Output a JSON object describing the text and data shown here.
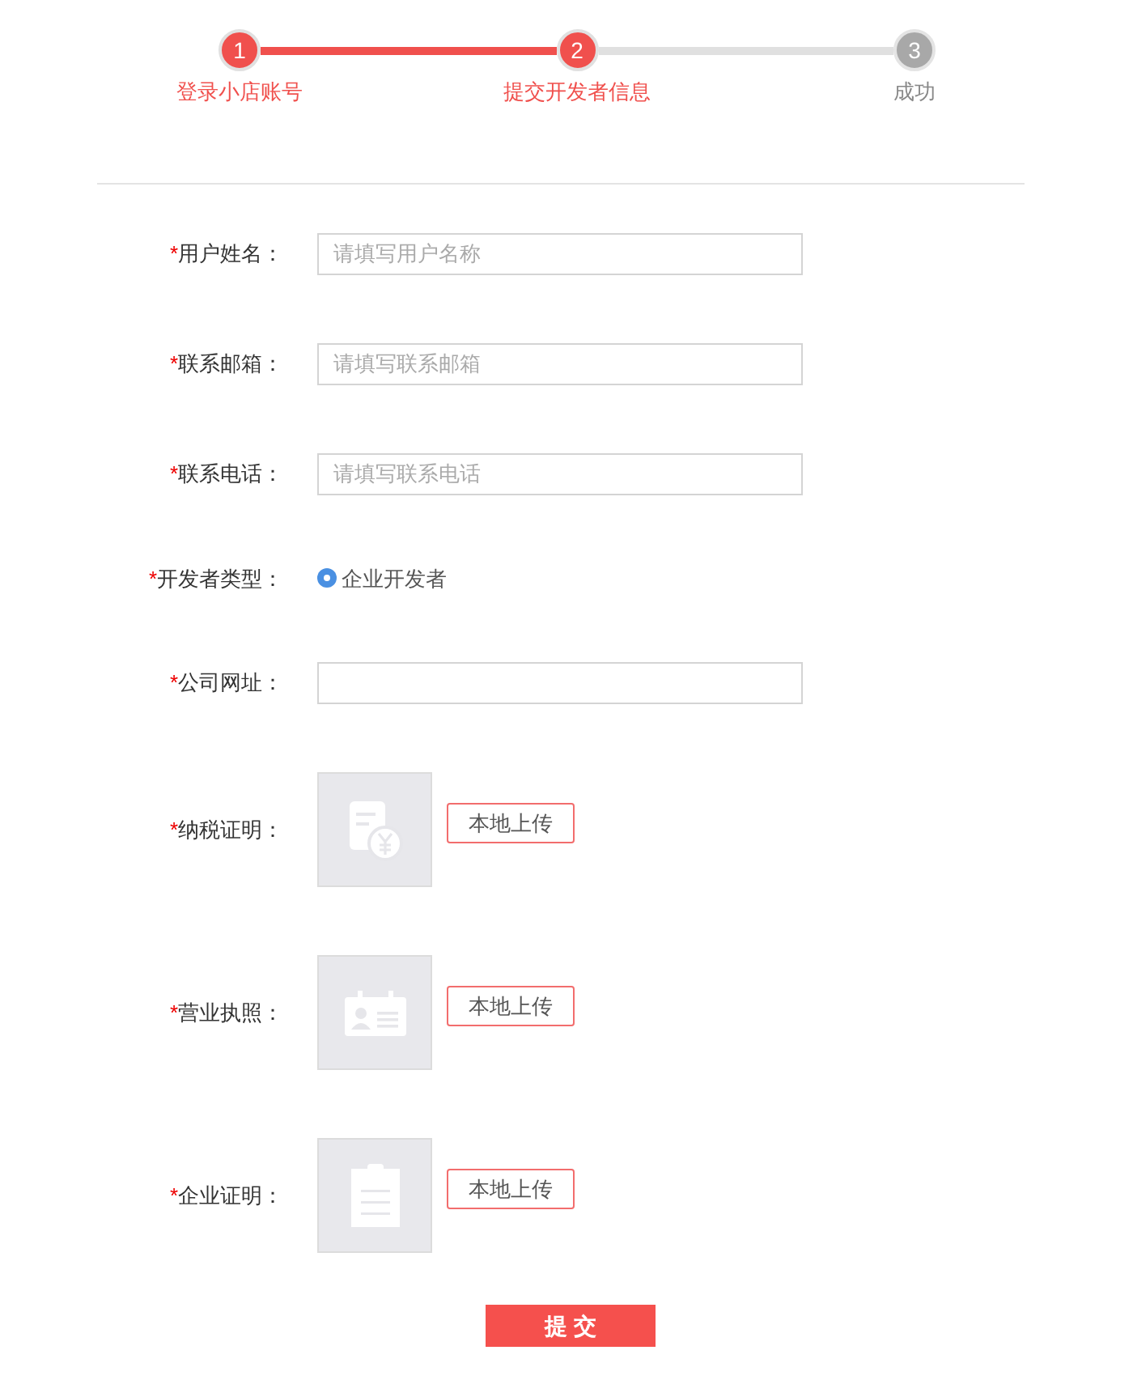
{
  "steps": [
    {
      "number": "1",
      "label": "登录小店账号",
      "active": true
    },
    {
      "number": "2",
      "label": "提交开发者信息",
      "active": true
    },
    {
      "number": "3",
      "label": "成功",
      "active": false
    }
  ],
  "fields": [
    {
      "kind": "text",
      "mark": "*",
      "label": "用户姓名：",
      "placeholder": "请填写用户名称"
    },
    {
      "kind": "text",
      "mark": "*",
      "label": "联系邮箱：",
      "placeholder": "请填写联系邮箱"
    },
    {
      "kind": "text",
      "mark": "*",
      "label": "联系电话：",
      "placeholder": "请填写联系电话"
    },
    {
      "kind": "radio",
      "mark": "*",
      "label": "开发者类型：",
      "options": [
        {
          "label": "企业开发者",
          "selected": true
        }
      ]
    },
    {
      "kind": "text",
      "mark": "*",
      "label": "公司网址："
    },
    {
      "kind": "upload",
      "mark": "*",
      "label": "纳税证明：",
      "button": "本地上传"
    },
    {
      "kind": "upload",
      "mark": "*",
      "label": "营业执照：",
      "button": "本地上传"
    },
    {
      "kind": "upload",
      "mark": "*",
      "label": "企业证明：",
      "button": "本地上传"
    }
  ],
  "submit": "提 交"
}
